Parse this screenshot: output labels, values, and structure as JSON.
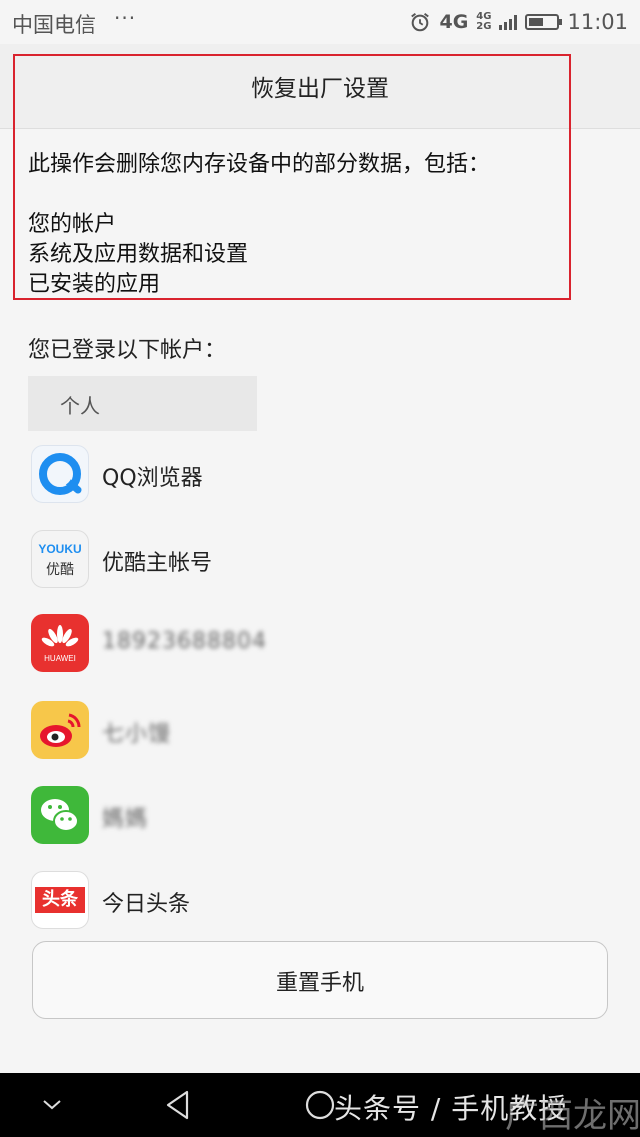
{
  "status_bar": {
    "carrier": "中国电信",
    "overflow": "···",
    "network_main": "4G",
    "network_stack": [
      "4G",
      "2G"
    ],
    "time": "11:01",
    "battery_level": 0.55
  },
  "header": {
    "title": "恢复出厂设置"
  },
  "warning": {
    "intro": "此操作会删除您内存设备中的部分数据，包括：",
    "items": [
      "您的帐户",
      "系统及应用数据和设置",
      "已安装的应用"
    ]
  },
  "accounts": {
    "label": "您已登录以下帐户：",
    "group": "个人",
    "items": [
      {
        "name": "QQ浏览器",
        "icon": "qq-browser-icon"
      },
      {
        "name": "优酷主帐号",
        "icon": "youku-icon",
        "icon_text_top": "YOUKU",
        "icon_text_bottom": "优酷"
      },
      {
        "name": "18923688804",
        "icon": "huawei-icon",
        "icon_text": "HUAWEI"
      },
      {
        "name": "七小馒",
        "icon": "weibo-icon"
      },
      {
        "name": "媽媽",
        "icon": "wechat-icon"
      },
      {
        "name": "今日头条",
        "icon": "toutiao-icon",
        "icon_text": "头条"
      }
    ]
  },
  "reset_button": {
    "label": "重置手机"
  },
  "nav": {
    "watermark": "头条号 / 手机教授",
    "corner_mark": "广西龙网"
  },
  "colors": {
    "highlight_box": "#d9232e",
    "huawei": "#e8312f",
    "wechat": "#3fb83a",
    "toutiao": "#e8312f"
  }
}
